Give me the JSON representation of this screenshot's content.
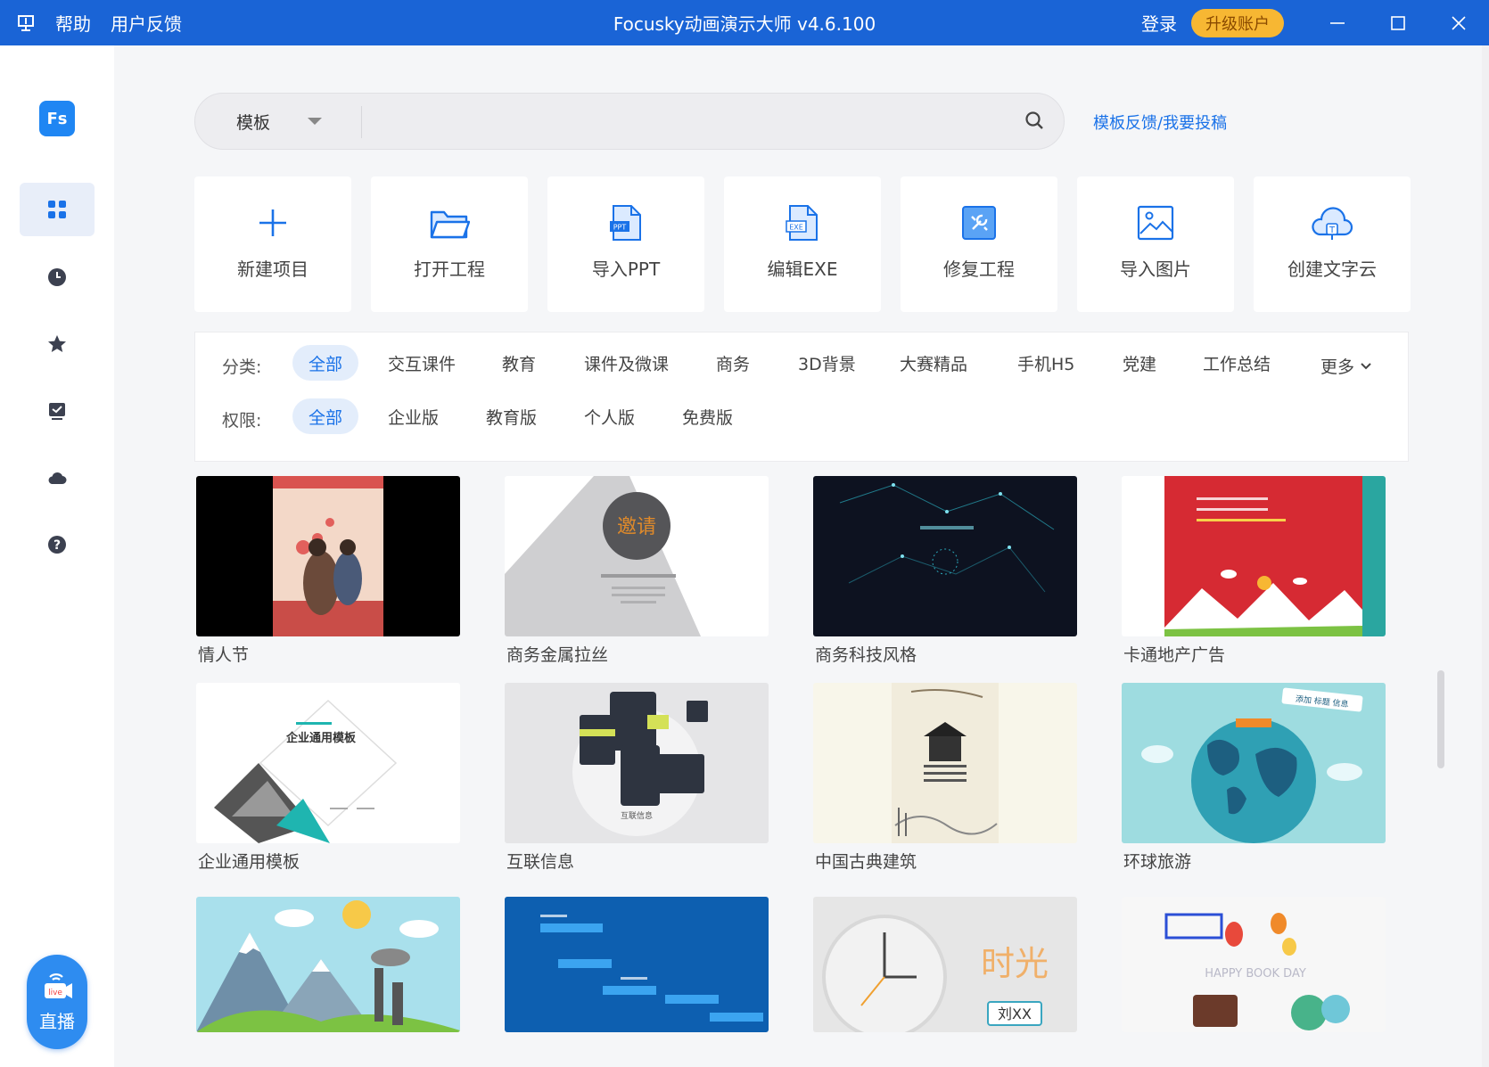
{
  "titlebar": {
    "menu_help": "帮助",
    "menu_feedback": "用户反馈",
    "title": "Focusky动画演示大师 v4.6.100",
    "login": "登录",
    "upgrade": "升级账户"
  },
  "sidebar": {
    "logo_text": "Fs",
    "live_badge": "live",
    "live_label": "直播",
    "items": [
      {
        "icon": "grid-icon",
        "active": true
      },
      {
        "icon": "clock-icon",
        "active": false
      },
      {
        "icon": "star-icon",
        "active": false
      },
      {
        "icon": "checkbox-icon",
        "active": false
      },
      {
        "icon": "cloud-icon",
        "active": false
      },
      {
        "icon": "help-icon",
        "active": false
      }
    ]
  },
  "search": {
    "type_value": "模板",
    "placeholder": "",
    "feedback_link": "模板反馈/我要投稿"
  },
  "actions": [
    {
      "label": "新建项目",
      "icon": "plus-icon"
    },
    {
      "label": "打开工程",
      "icon": "folder-icon"
    },
    {
      "label": "导入PPT",
      "icon": "ppt-file-icon",
      "badge": "PPT"
    },
    {
      "label": "编辑EXE",
      "icon": "exe-file-icon",
      "badge": "EXE"
    },
    {
      "label": "修复工程",
      "icon": "repair-icon"
    },
    {
      "label": "导入图片",
      "icon": "image-icon"
    },
    {
      "label": "创建文字云",
      "icon": "word-cloud-icon",
      "badge": "T"
    }
  ],
  "filters": {
    "category_label": "分类:",
    "categories": [
      "全部",
      "交互课件",
      "教育",
      "课件及微课",
      "商务",
      "3D背景",
      "大赛精品",
      "手机H5",
      "党建",
      "工作总结"
    ],
    "more": "更多",
    "permission_label": "权限:",
    "permissions": [
      "全部",
      "企业版",
      "教育版",
      "个人版",
      "免费版"
    ]
  },
  "templates": [
    {
      "name": "情人节"
    },
    {
      "name": "商务金属拉丝",
      "thumb_text": "邀请"
    },
    {
      "name": "商务科技风格"
    },
    {
      "name": "卡通地产广告"
    },
    {
      "name": "企业通用模板",
      "thumb_text": "企业通用模板"
    },
    {
      "name": "互联信息",
      "thumb_text": "互联信息"
    },
    {
      "name": "中国古典建筑"
    },
    {
      "name": "环球旅游",
      "thumb_text": "添加 标题 信息"
    },
    {
      "name": ""
    },
    {
      "name": ""
    },
    {
      "name": "",
      "thumb_text": "时光",
      "thumb_sub": "刘XX"
    },
    {
      "name": "",
      "thumb_text": "HAPPY BOOK DAY"
    }
  ],
  "colors": {
    "titlebar": "#1a64d6",
    "accent": "#1a72e8",
    "upgrade": "#f7b733"
  }
}
